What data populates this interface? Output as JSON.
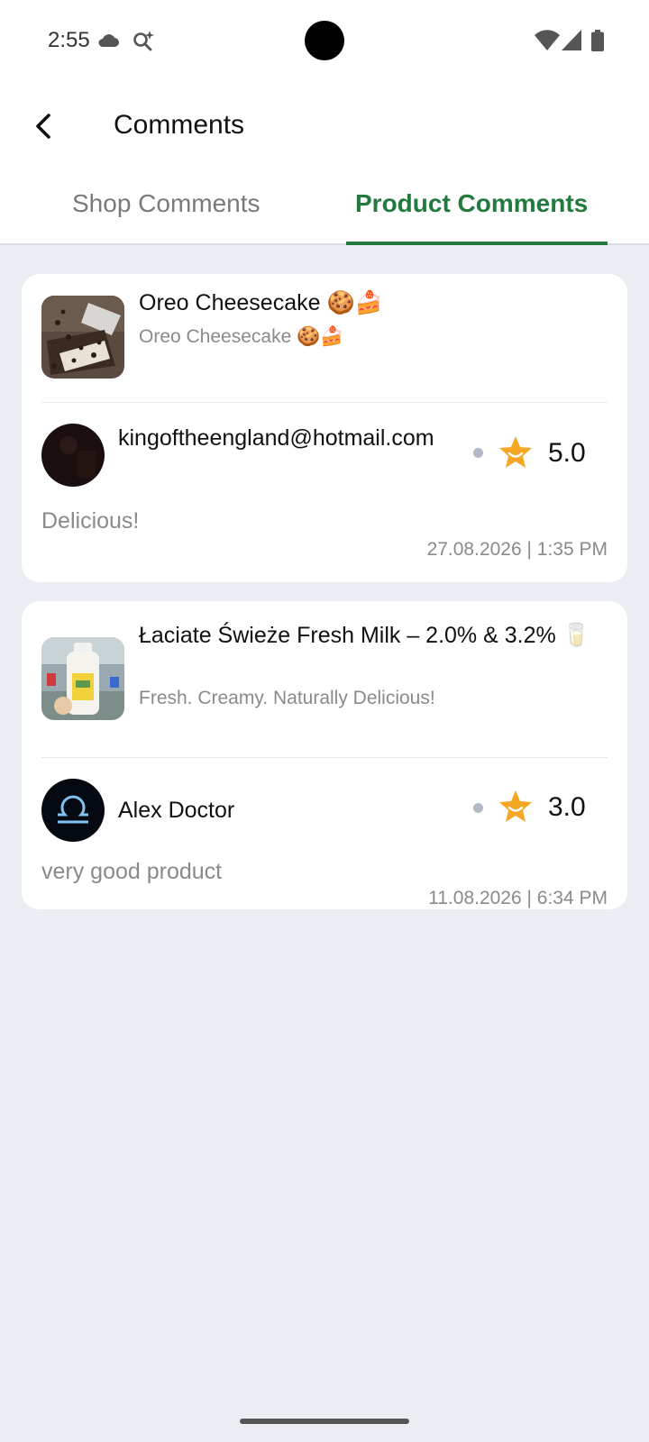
{
  "status": {
    "time": "2:55"
  },
  "header": {
    "title": "Comments"
  },
  "tabs": [
    {
      "label": "Shop Comments",
      "active": false
    },
    {
      "label": "Product Comments",
      "active": true
    }
  ],
  "comments": [
    {
      "product_name": "Oreo Cheesecake 🍪🍰",
      "product_desc": "Oreo Cheesecake 🍪🍰",
      "user": "kingoftheengland@hotmail.com",
      "rating": "5.0",
      "text": "Delicious!",
      "date": "27.08.2026 | 1:35 PM"
    },
    {
      "product_name": "Łaciate Świeże Fresh Milk – 2.0% & 3.2% 🥛",
      "product_desc": "Fresh. Creamy. Naturally Delicious!",
      "user": "Alex Doctor",
      "rating": "3.0",
      "text": "very good product",
      "date": "11.08.2026 | 6:34 PM"
    }
  ],
  "colors": {
    "accent": "#227a3e",
    "star": "#f5a623",
    "background": "#eaedf2"
  }
}
